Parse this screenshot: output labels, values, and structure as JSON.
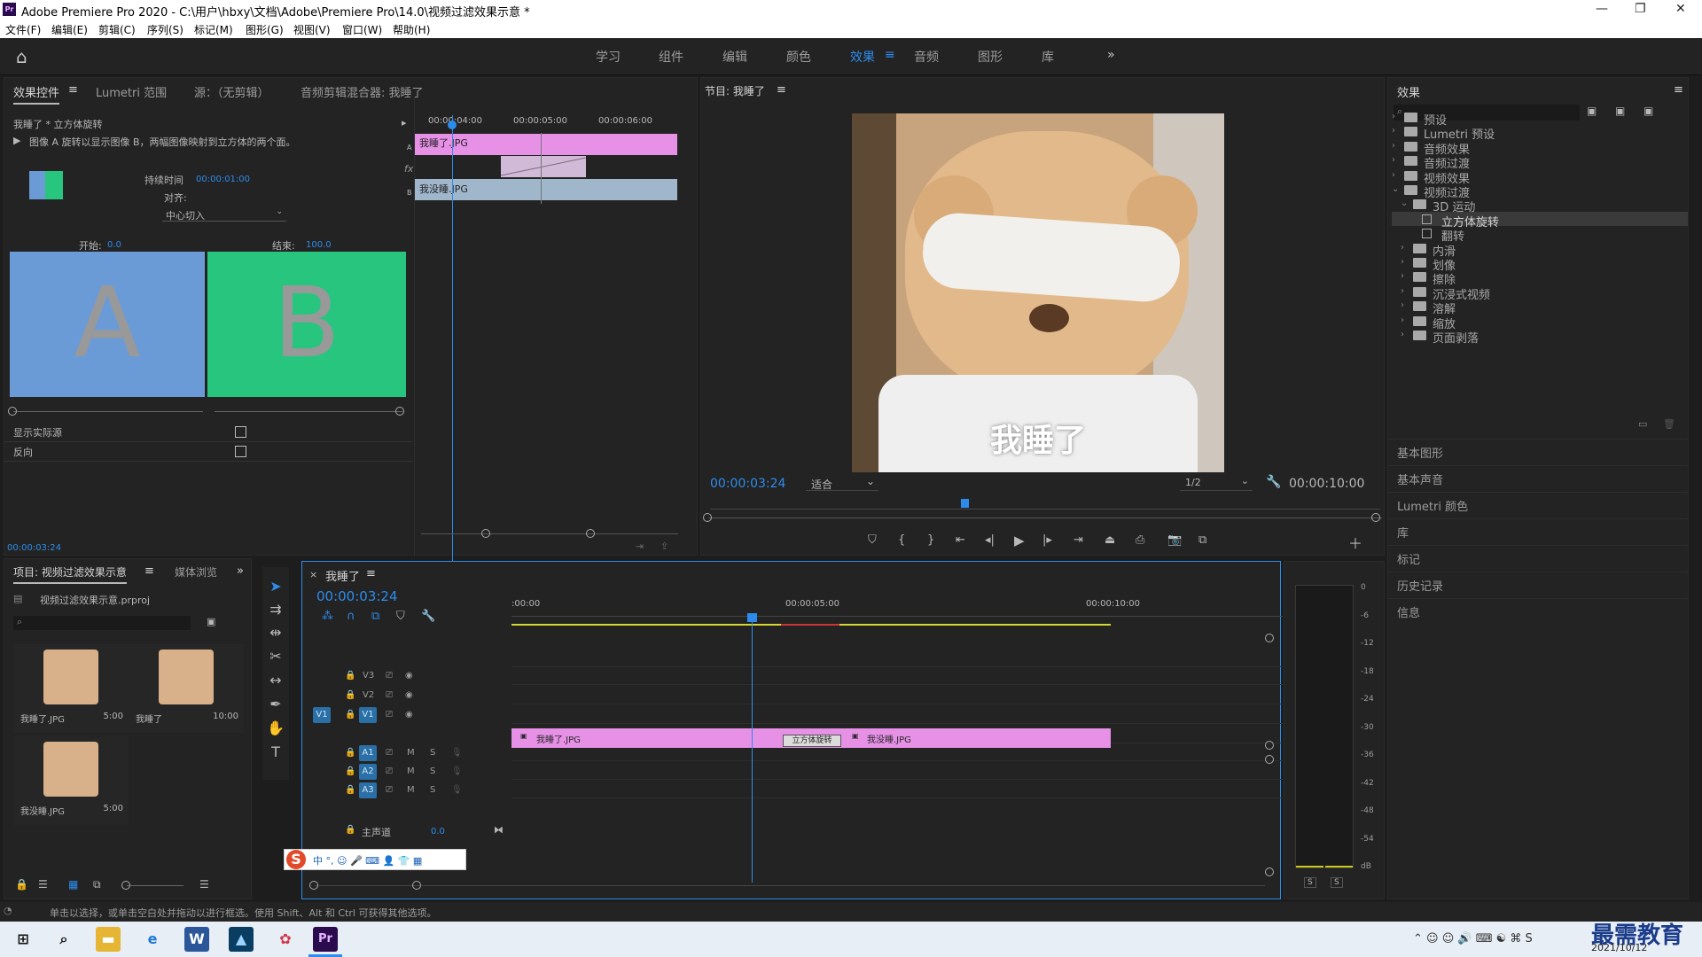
{
  "window": {
    "title": "Adobe Premiere Pro 2020 - C:\\用户\\hbxy\\文档\\Adobe\\Premiere Pro\\14.0\\视频过滤效果示意 *"
  },
  "menu": [
    "文件(F)",
    "编辑(E)",
    "剪辑(C)",
    "序列(S)",
    "标记(M)",
    "图形(G)",
    "视图(V)",
    "窗口(W)",
    "帮助(H)"
  ],
  "workspaces": [
    "学习",
    "组件",
    "编辑",
    "颜色",
    "效果",
    "音频",
    "图形",
    "库"
  ],
  "workspace_active": "效果",
  "effect_controls": {
    "tabs": [
      "效果控件",
      "Lumetri 范围",
      "源：（无剪辑）",
      "音频剪辑混合器: 我睡了"
    ],
    "clip_title": "我睡了 * 立方体旋转",
    "description": "图像 A 旋转以显示图像 B，两幅图像映射到立方体的两个面。",
    "duration_label": "持续时间",
    "duration_value": "00:00:01:00",
    "align_label": "对齐:",
    "align_value": "中心切入",
    "start_label": "开始:",
    "start_value": "0.0",
    "end_label": "结束:",
    "end_value": "100.0",
    "preview_a": "A",
    "preview_b": "B",
    "show_actual_label": "显示实际源",
    "reverse_label": "反向",
    "time_ruler": [
      "00:00:04:00",
      "00:00:05:00",
      "00:00:06:00"
    ],
    "track_a_clip": "我睡了.JPG",
    "track_b_clip": "我没睡.JPG",
    "track_a_letter": "A",
    "track_b_letter": "B",
    "fx_label": "fx",
    "current_time": "00:00:03:24"
  },
  "program": {
    "title": "节目: 我睡了",
    "caption": "我睡了",
    "timecode": "00:00:03:24",
    "fit": "适合",
    "resolution": "1/2",
    "duration": "00:00:10:00"
  },
  "effects_panel": {
    "title": "效果",
    "items": [
      {
        "label": "预设",
        "level": 0
      },
      {
        "label": "Lumetri 预设",
        "level": 0
      },
      {
        "label": "音频效果",
        "level": 0
      },
      {
        "label": "音频过渡",
        "level": 0
      },
      {
        "label": "视频效果",
        "level": 0
      },
      {
        "label": "视频过渡",
        "level": 0,
        "open": true
      },
      {
        "label": "3D 运动",
        "level": 1,
        "open": true
      },
      {
        "label": "立方体旋转",
        "level": 2,
        "selected": true
      },
      {
        "label": "翻转",
        "level": 2
      },
      {
        "label": "内滑",
        "level": 1
      },
      {
        "label": "划像",
        "level": 1
      },
      {
        "label": "擦除",
        "level": 1
      },
      {
        "label": "沉浸式视频",
        "level": 1
      },
      {
        "label": "溶解",
        "level": 1
      },
      {
        "label": "缩放",
        "level": 1
      },
      {
        "label": "页面剥落",
        "level": 1
      }
    ],
    "collapsed_panels": [
      "基本图形",
      "基本声音",
      "Lumetri 颜色",
      "库",
      "标记",
      "历史记录",
      "信息"
    ]
  },
  "project": {
    "tabs": [
      "项目: 视频过滤效果示意",
      "媒体浏览"
    ],
    "file": "视频过滤效果示意.prproj",
    "items": [
      {
        "name": "我睡了.JPG",
        "duration": "5:00"
      },
      {
        "name": "我睡了",
        "duration": "10:00"
      },
      {
        "name": "我没睡.JPG",
        "duration": "5:00"
      }
    ]
  },
  "timeline": {
    "title": "我睡了",
    "timecode": "00:00:03:24",
    "ruler": [
      ":00:00",
      "00:00:05:00",
      "00:00:10:00"
    ],
    "video_tracks": [
      "V3",
      "V2",
      "V1"
    ],
    "audio_tracks": [
      "A1",
      "A2",
      "A3"
    ],
    "master_label": "主声道",
    "master_value": "0.0",
    "source_patch": "V1",
    "clip1": "我睡了.JPG",
    "clip2": "我没睡.JPG",
    "transition": "立方体旋转",
    "mute": "M",
    "solo": "S"
  },
  "meter": {
    "labels": [
      "0",
      "-6",
      "-12",
      "-18",
      "-24",
      "-30",
      "-36",
      "-42",
      "-48",
      "-54",
      "dB"
    ],
    "solo": [
      "S",
      "S"
    ]
  },
  "status": "单击以选择，或单击空白处并拖动以进行框选。使用 Shift、Alt 和 Ctrl 可获得其他选项。",
  "taskbar": {
    "date": "2021/10/12",
    "watermark": "最需教育"
  },
  "colors": {
    "accent": "#2d8ceb",
    "clip_pink": "#e690e6",
    "clip_blue": "#9fb6cb",
    "preview_a": "#6b9bd6",
    "preview_b": "#28c57f",
    "ruler_yellow": "#d7d734"
  }
}
